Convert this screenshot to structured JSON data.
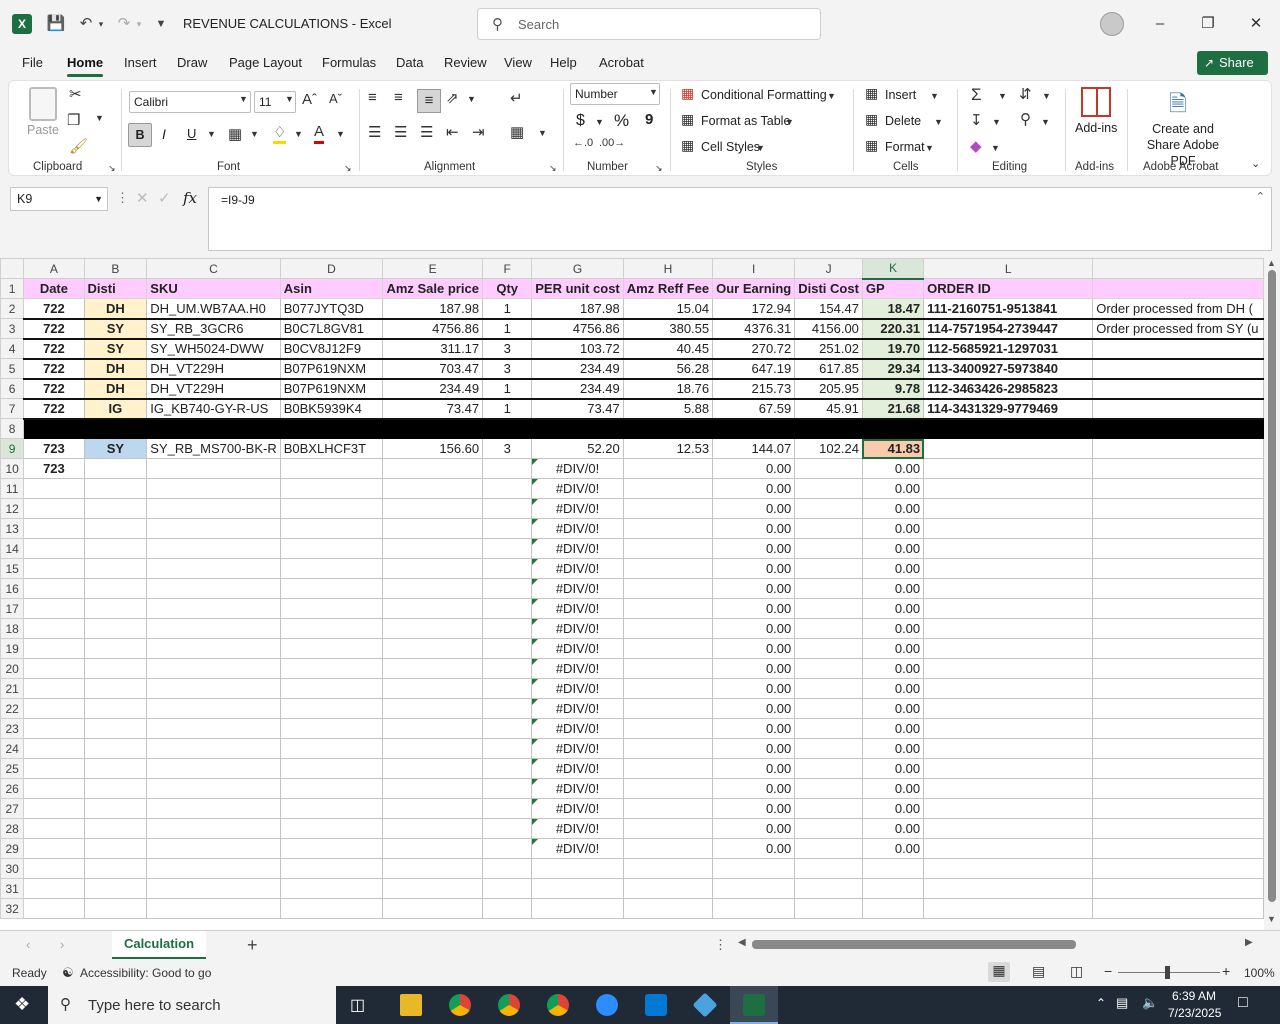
{
  "window": {
    "title": "REVENUE CALCULATIONS  -  Excel",
    "search_placeholder": "Search",
    "app_icon": "excel-logo-icon",
    "share_label": "Share"
  },
  "menu": [
    "File",
    "Home",
    "Insert",
    "Draw",
    "Page Layout",
    "Formulas",
    "Data",
    "Review",
    "View",
    "Help",
    "Acrobat"
  ],
  "ribbon": {
    "clipboard": {
      "paste": "Paste",
      "label": "Clipboard"
    },
    "font": {
      "name": "Calibri",
      "size": "11",
      "label": "Font",
      "bold": "B",
      "italic": "I",
      "underline": "U"
    },
    "alignment": {
      "label": "Alignment"
    },
    "number": {
      "format": "Number",
      "label": "Number",
      "dollar": "$",
      "percent": "%",
      "comma": "9"
    },
    "styles": {
      "conditional": "Conditional Formatting",
      "format_table": "Format as Table",
      "cell_styles": "Cell Styles",
      "label": "Styles"
    },
    "cells": {
      "insert": "Insert",
      "delete": "Delete",
      "format": "Format",
      "label": "Cells"
    },
    "editing": {
      "label": "Editing"
    },
    "addins": {
      "button": "Add-ins",
      "label": "Add-ins"
    },
    "acrobat": {
      "button": "Create and Share Adobe PDF",
      "label": "Adobe Acrobat"
    }
  },
  "formula_bar": {
    "name_box": "K9",
    "formula": "=I9-J9",
    "fx": "fx"
  },
  "columns": [
    "A",
    "B",
    "C",
    "D",
    "E",
    "F",
    "G",
    "H",
    "I",
    "J",
    "K",
    "L"
  ],
  "header_row": [
    "Date",
    "Disti",
    "SKU",
    "Asin",
    "Amz Sale price",
    "Qty",
    "PER unit cost",
    "Amz Reff Fee",
    "Our Earning",
    "Disti Cost",
    "GP",
    "ORDER ID",
    ""
  ],
  "rows": [
    {
      "date": "722",
      "disti": "DH",
      "sku": "DH_UM.WB7AA.H0",
      "asin": "B077JYTQ3D",
      "sale": "187.98",
      "qty": "1",
      "unit": "187.98",
      "fee": "15.04",
      "earn": "172.94",
      "cost": "154.47",
      "gp": "18.47",
      "order": "111-2160751-9513841",
      "note": "Order processed from DH ("
    },
    {
      "date": "722",
      "disti": "SY",
      "sku": "SY_RB_3GCR6",
      "asin": "B0C7L8GV81",
      "sale": "4756.86",
      "qty": "1",
      "unit": "4756.86",
      "fee": "380.55",
      "earn": "4376.31",
      "cost": "4156.00",
      "gp": "220.31",
      "order": "114-7571954-2739447",
      "note": "Order processed from SY (u"
    },
    {
      "date": "722",
      "disti": "SY",
      "sku": "SY_WH5024-DWW",
      "asin": "B0CV8J12F9",
      "sale": "311.17",
      "qty": "3",
      "unit": "103.72",
      "fee": "40.45",
      "earn": "270.72",
      "cost": "251.02",
      "gp": "19.70",
      "order": "112-5685921-1297031",
      "note": ""
    },
    {
      "date": "722",
      "disti": "DH",
      "sku": "DH_VT229H",
      "asin": "B07P619NXM",
      "sale": "703.47",
      "qty": "3",
      "unit": "234.49",
      "fee": "56.28",
      "earn": "647.19",
      "cost": "617.85",
      "gp": "29.34",
      "order": "113-3400927-5973840",
      "note": ""
    },
    {
      "date": "722",
      "disti": "DH",
      "sku": "DH_VT229H",
      "asin": "B07P619NXM",
      "sale": "234.49",
      "qty": "1",
      "unit": "234.49",
      "fee": "18.76",
      "earn": "215.73",
      "cost": "205.95",
      "gp": "9.78",
      "order": "112-3463426-2985823",
      "note": ""
    },
    {
      "date": "722",
      "disti": "IG",
      "sku": "IG_KB740-GY-R-US",
      "asin": "B0BK5939K4",
      "sale": "73.47",
      "qty": "1",
      "unit": "73.47",
      "fee": "5.88",
      "earn": "67.59",
      "cost": "45.91",
      "gp": "21.68",
      "order": "114-3431329-9779469",
      "note": ""
    }
  ],
  "row9": {
    "date": "723",
    "disti": "SY",
    "sku": "SY_RB_MS700-BK-R",
    "asin": "B0BXLHCF3T",
    "sale": "156.60",
    "qty": "3",
    "unit": "52.20",
    "fee": "12.53",
    "earn": "144.07",
    "cost": "102.24",
    "gp": "41.83"
  },
  "row10_date": "723",
  "empty_calc": {
    "unit": "#DIV/0!",
    "earn": "0.00",
    "gp": "0.00"
  },
  "sheet_tab": "Calculation",
  "status": {
    "ready": "Ready",
    "accessibility": "Accessibility: Good to go",
    "zoom": "100%"
  },
  "taskbar": {
    "search": "Type here to search",
    "time": "6:39 AM",
    "date": "7/23/2025"
  },
  "colors": {
    "excel_green": "#1d6f42",
    "header_pink": "#ffccff",
    "disti_yellow": "#fff2cc",
    "gp_green": "#e2efda",
    "selected_orange": "#f8cbad",
    "disti_blue": "#bdd7ee"
  }
}
